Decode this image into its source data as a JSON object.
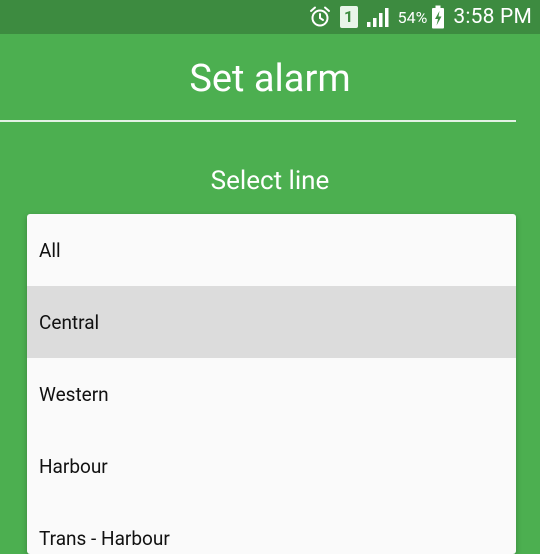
{
  "status_bar": {
    "icons": [
      "alarm-clock-icon",
      "sim-1-icon",
      "signal-icon",
      "battery-charging-icon"
    ],
    "sim_label": "1",
    "battery_percent": "54%",
    "time": "3:58 PM"
  },
  "header": {
    "title": "Set alarm"
  },
  "section": {
    "subtitle": "Select line"
  },
  "dropdown": {
    "options": [
      "All",
      "Central",
      "Western",
      "Harbour",
      "Trans - Harbour"
    ],
    "highlighted": "Central"
  },
  "colors": {
    "background": "#4caf50",
    "status_bar": "#3d8b40",
    "dropdown_bg": "#fafafa",
    "highlight": "#dcdcdc",
    "text_light": "#ffffff",
    "text_dark": "#111111"
  }
}
